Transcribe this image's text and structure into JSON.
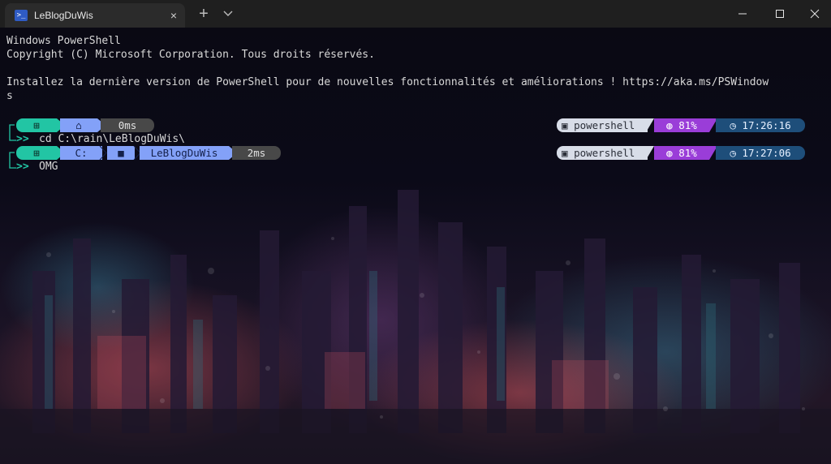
{
  "window": {
    "tab_title": "LeBlogDuWis",
    "tab_icon": "powershell-icon",
    "new_tab_label": "+",
    "close_label": "×"
  },
  "terminal": {
    "banner": [
      "Windows PowerShell",
      "Copyright (C) Microsoft Corporation. Tous droits réservés.",
      "",
      "Installez la dernière version de PowerShell pour de nouvelles fonctionnalités et améliorations ! https://aka.ms/PSWindow",
      "s"
    ],
    "prompts": [
      {
        "left_segments": [
          {
            "icon": "windows-icon",
            "text": "⊞"
          },
          {
            "icon": "home-icon",
            "text": "⌂"
          },
          {
            "text": "0ms"
          }
        ],
        "right_segments": [
          {
            "icon": "shell-icon",
            "text": "powershell"
          },
          {
            "icon": "battery-icon",
            "text": "81%"
          },
          {
            "icon": "clock-icon",
            "text": "17:26:16"
          }
        ],
        "command": "cd C:\\rain\\LeBlogDuWis\\"
      },
      {
        "left_segments": [
          {
            "icon": "windows-icon",
            "text": "⊞"
          },
          {
            "text": "C:"
          },
          {
            "icon": "folder-icon",
            "text": "■"
          },
          {
            "text": "LeBlogDuWis"
          },
          {
            "text": "2ms"
          }
        ],
        "right_segments": [
          {
            "icon": "shell-icon",
            "text": "powershell"
          },
          {
            "icon": "battery-icon",
            "text": "81%"
          },
          {
            "icon": "clock-icon",
            "text": "17:27:06"
          }
        ],
        "command": "OMG"
      }
    ],
    "prompt_chevron": ">>"
  },
  "colors": {
    "os_segment": "#22c5a4",
    "path_segment": "#83a1f8",
    "time_segment": "#484848",
    "shell_segment": "#d8dde8",
    "battery_segment": "#9a3dd8",
    "clock_segment": "#1e4e7a",
    "chevron": "#22c5a4"
  }
}
